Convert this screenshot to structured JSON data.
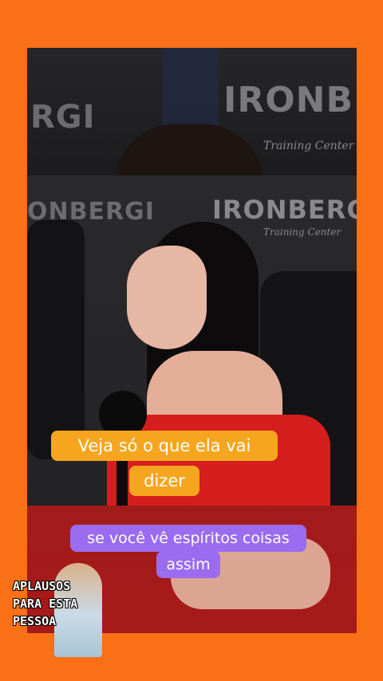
{
  "background_color": "#f97016",
  "video": {
    "wall_brand": "IRONBERG",
    "wall_brand_partial_left": "RGI",
    "wall_brand_mid_left": "ONBERGI",
    "wall_sub": "Training Center"
  },
  "captions": {
    "line1": "Veja só o que ela vai",
    "line2": "dizer",
    "line3": "se você vê espíritos coisas",
    "line4": "assim"
  },
  "logo": {
    "text": "APLAUSOS\nPARA ESTA\nPESSOA"
  },
  "colors": {
    "caption_yellow": "#f6a61e",
    "caption_purple": "#9b6bf0"
  }
}
